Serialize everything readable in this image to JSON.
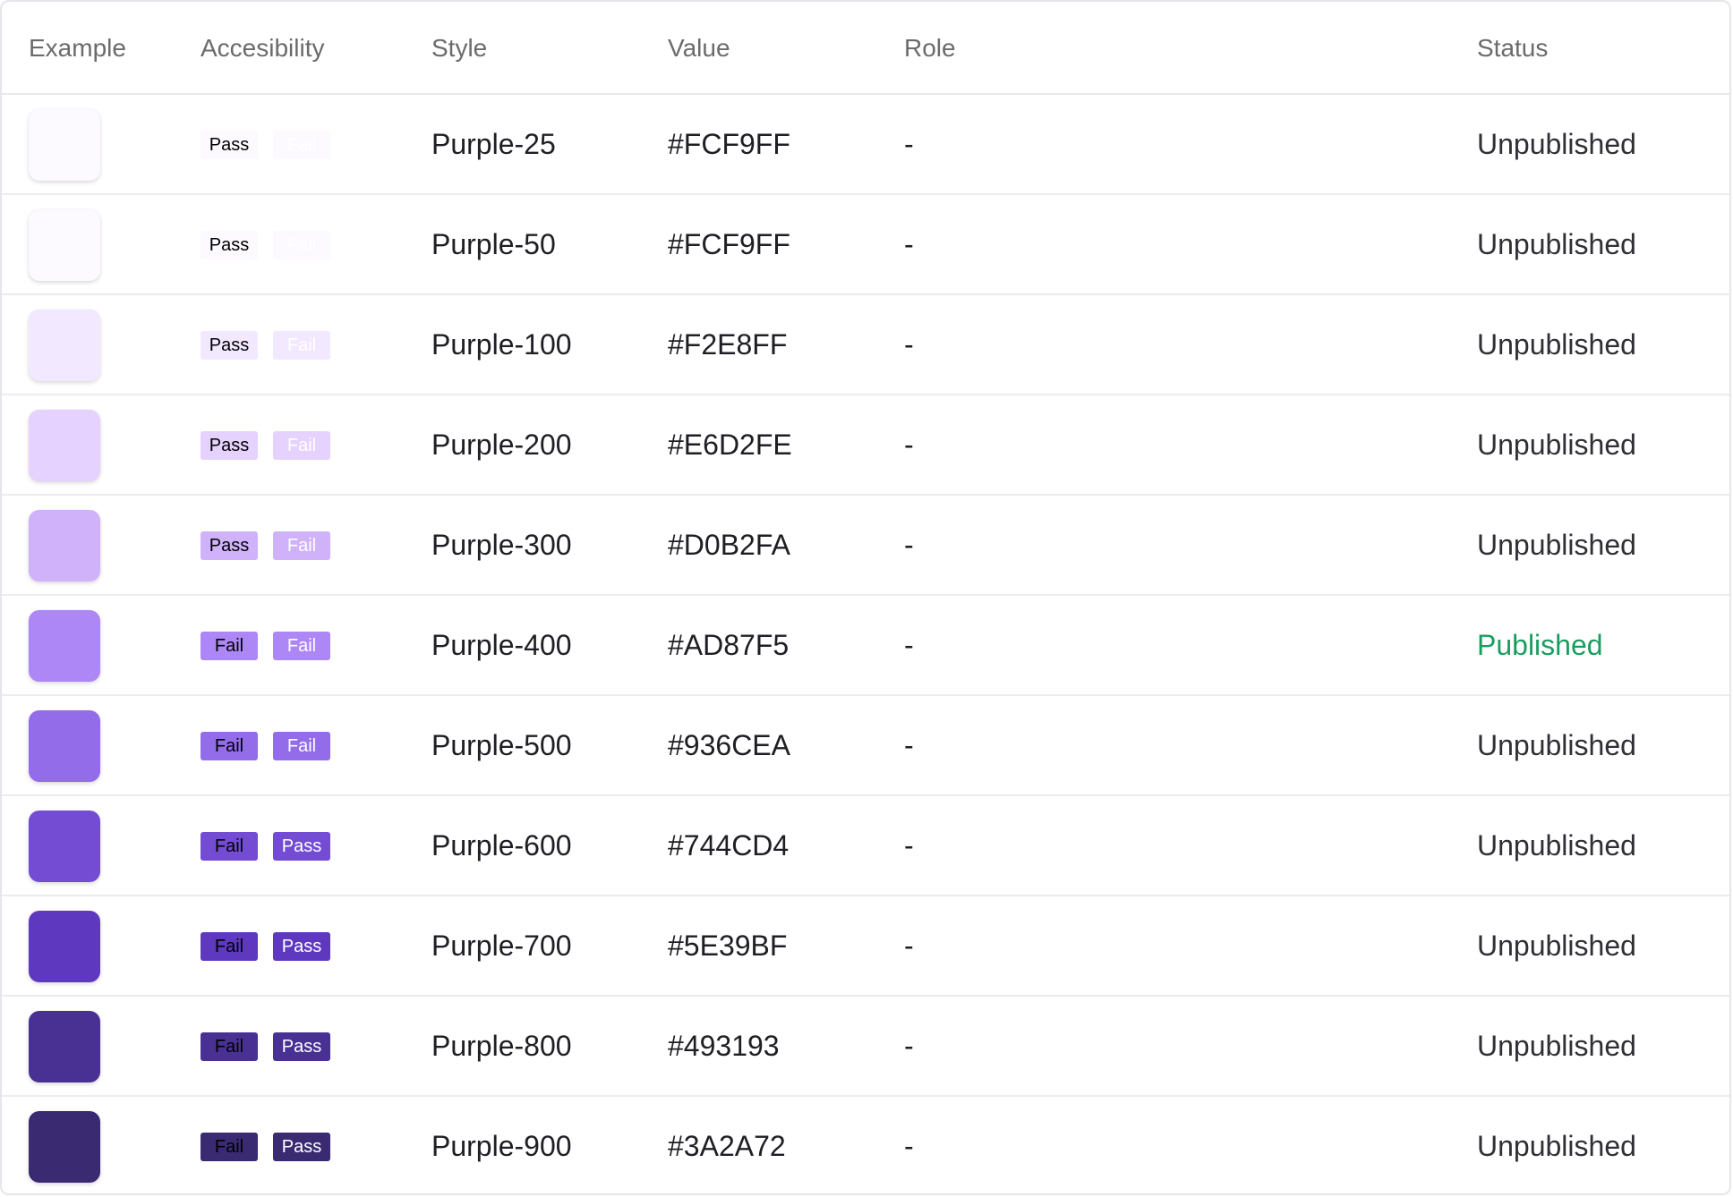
{
  "headers": {
    "example": "Example",
    "accessibility": "Accesibility",
    "style": "Style",
    "value": "Value",
    "role": "Role",
    "status": "Status"
  },
  "colors": {
    "published": "#1a9e60",
    "dark_text": "#000000",
    "light_text": "#ffffff"
  },
  "rows": [
    {
      "style": "Purple-25",
      "value": "#FCF9FF",
      "role": "-",
      "status": "Unpublished",
      "badge1": "Pass",
      "badge2": "Fail",
      "swatch": "#FCF9FF"
    },
    {
      "style": "Purple-50",
      "value": "#FCF9FF",
      "role": "-",
      "status": "Unpublished",
      "badge1": "Pass",
      "badge2": "Fail",
      "swatch": "#FCF9FF"
    },
    {
      "style": "Purple-100",
      "value": "#F2E8FF",
      "role": "-",
      "status": "Unpublished",
      "badge1": "Pass",
      "badge2": "Fail",
      "swatch": "#F2E8FF"
    },
    {
      "style": "Purple-200",
      "value": "#E6D2FE",
      "role": "-",
      "status": "Unpublished",
      "badge1": "Pass",
      "badge2": "Fail",
      "swatch": "#E6D2FE"
    },
    {
      "style": "Purple-300",
      "value": "#D0B2FA",
      "role": "-",
      "status": "Unpublished",
      "badge1": "Pass",
      "badge2": "Fail",
      "swatch": "#D0B2FA"
    },
    {
      "style": "Purple-400",
      "value": "#AD87F5",
      "role": "-",
      "status": "Published",
      "badge1": "Fail",
      "badge2": "Fail",
      "swatch": "#AD87F5"
    },
    {
      "style": "Purple-500",
      "value": "#936CEA",
      "role": "-",
      "status": "Unpublished",
      "badge1": "Fail",
      "badge2": "Fail",
      "swatch": "#936CEA"
    },
    {
      "style": "Purple-600",
      "value": "#744CD4",
      "role": "-",
      "status": "Unpublished",
      "badge1": "Fail",
      "badge2": "Pass",
      "swatch": "#744CD4"
    },
    {
      "style": "Purple-700",
      "value": "#5E39BF",
      "role": "-",
      "status": "Unpublished",
      "badge1": "Fail",
      "badge2": "Pass",
      "swatch": "#5E39BF"
    },
    {
      "style": "Purple-800",
      "value": "#493193",
      "role": "-",
      "status": "Unpublished",
      "badge1": "Fail",
      "badge2": "Pass",
      "swatch": "#493193"
    },
    {
      "style": "Purple-900",
      "value": "#3A2A72",
      "role": "-",
      "status": "Unpublished",
      "badge1": "Fail",
      "badge2": "Pass",
      "swatch": "#3A2A72"
    }
  ]
}
